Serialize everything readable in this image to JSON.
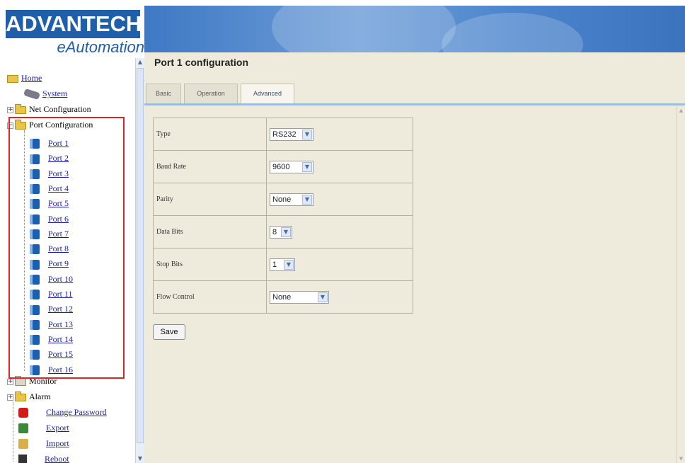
{
  "logo": {
    "brand": "ADVANTECH",
    "sub": "eAutomation"
  },
  "tree": {
    "home": "Home",
    "system": "System",
    "net_config": "Net Configuration",
    "port_config": "Port Configuration",
    "ports": [
      "Port 1",
      "Port 2",
      "Port 3",
      "Port 4",
      "Port 5",
      "Port 6",
      "Port 7",
      "Port 8",
      "Port 9",
      "Port 10",
      "Port 11",
      "Port 12",
      "Port 13",
      "Port 14",
      "Port 15",
      "Port 16"
    ],
    "monitor": "Monitor",
    "alarm": "Alarm",
    "change_password": "Change Password",
    "export": "Export",
    "import": "Import",
    "reboot": "Reboot"
  },
  "page": {
    "title": "Port 1 configuration"
  },
  "tabs": [
    {
      "label": "Basic",
      "active": false
    },
    {
      "label": "Operation",
      "active": false
    },
    {
      "label": "Advanced",
      "active": true
    }
  ],
  "config": [
    {
      "label": "Type",
      "value": "RS232"
    },
    {
      "label": "Baud Rate",
      "value": "9600"
    },
    {
      "label": "Parity",
      "value": "None"
    },
    {
      "label": "Data Bits",
      "value": "8"
    },
    {
      "label": "Stop Bits",
      "value": "1"
    },
    {
      "label": "Flow Control",
      "value": "None"
    }
  ],
  "save_label": "Save",
  "colors": {
    "brand": "#1f5fa9",
    "highlight": "#d9262b",
    "panel": "#eeebdc",
    "link": "#1a1aa6"
  },
  "icons": {
    "home": "folder-open-icon",
    "system": "system-icon",
    "folder": "folder-icon",
    "port": "port-icon",
    "lock": "lock-icon",
    "export": "export-icon",
    "import": "import-icon",
    "reboot": "reboot-icon"
  }
}
